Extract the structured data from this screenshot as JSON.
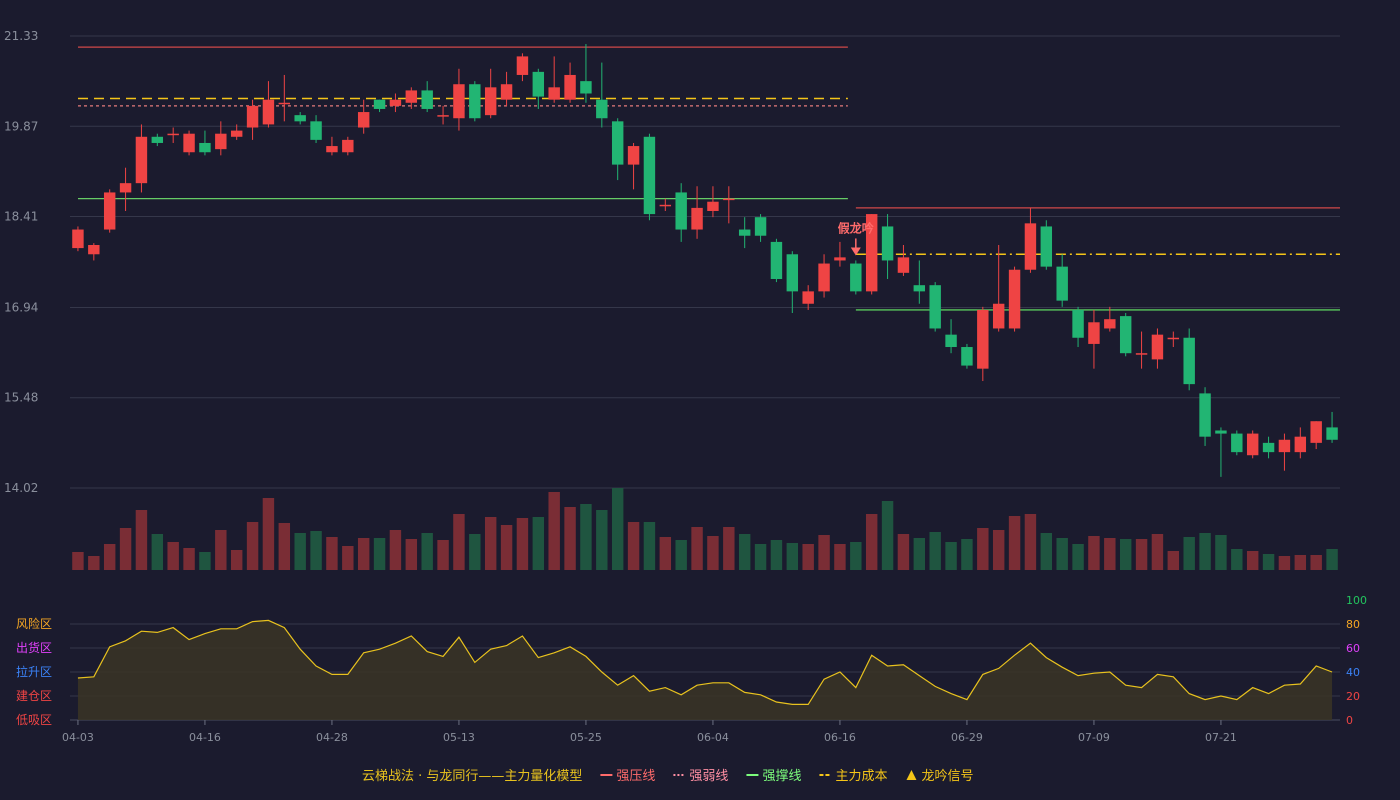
{
  "chart_data": {
    "type": "candlestick",
    "title": "",
    "colors": {
      "up": "#ef4444",
      "down": "#22b573",
      "vol_up": "#7a2d35",
      "vol_down": "#1f5540",
      "osc_line": "#e8c21e"
    },
    "y_axis": {
      "ticks": [
        "21.33",
        "19.87",
        "18.41",
        "16.94",
        "15.48",
        "14.02"
      ],
      "min": 14.02,
      "max": 21.33
    },
    "x_axis": {
      "ticks": [
        {
          "index": 0,
          "label": "04-03"
        },
        {
          "index": 8,
          "label": "04-16"
        },
        {
          "index": 16,
          "label": "04-28"
        },
        {
          "index": 24,
          "label": "05-13"
        },
        {
          "index": 32,
          "label": "05-25"
        },
        {
          "index": 40,
          "label": "06-04"
        },
        {
          "index": 48,
          "label": "06-16"
        },
        {
          "index": 56,
          "label": "06-29"
        },
        {
          "index": 64,
          "label": "07-09"
        },
        {
          "index": 72,
          "label": "07-21"
        }
      ]
    },
    "candles": [
      [
        17.9,
        18.2,
        18.25,
        17.85
      ],
      [
        17.8,
        17.95,
        17.98,
        17.7
      ],
      [
        18.2,
        18.8,
        18.85,
        18.15
      ],
      [
        18.8,
        18.95,
        19.2,
        18.5
      ],
      [
        18.95,
        19.7,
        19.9,
        18.8
      ],
      [
        19.7,
        19.6,
        19.75,
        19.55
      ],
      [
        19.75,
        19.75,
        19.85,
        19.6
      ],
      [
        19.45,
        19.75,
        19.8,
        19.4
      ],
      [
        19.6,
        19.45,
        19.8,
        19.4
      ],
      [
        19.5,
        19.75,
        19.95,
        19.4
      ],
      [
        19.7,
        19.8,
        19.9,
        19.65
      ],
      [
        19.85,
        20.2,
        20.3,
        19.65
      ],
      [
        19.9,
        20.3,
        20.6,
        19.85
      ],
      [
        20.25,
        20.25,
        20.7,
        19.95
      ],
      [
        20.05,
        19.95,
        20.1,
        19.9
      ],
      [
        19.95,
        19.65,
        20.05,
        19.6
      ],
      [
        19.45,
        19.55,
        19.7,
        19.4
      ],
      [
        19.45,
        19.65,
        19.7,
        19.4
      ],
      [
        19.85,
        20.1,
        20.3,
        19.75
      ],
      [
        20.3,
        20.15,
        20.3,
        20.1
      ],
      [
        20.2,
        20.3,
        20.4,
        20.1
      ],
      [
        20.25,
        20.45,
        20.5,
        20.15
      ],
      [
        20.45,
        20.15,
        20.6,
        20.1
      ],
      [
        20.05,
        20.05,
        20.2,
        19.9
      ],
      [
        20.0,
        20.55,
        20.8,
        19.8
      ],
      [
        20.55,
        20.0,
        20.6,
        19.95
      ],
      [
        20.05,
        20.5,
        20.8,
        20.0
      ],
      [
        20.3,
        20.55,
        20.75,
        20.2
      ],
      [
        20.7,
        21.0,
        21.05,
        20.6
      ],
      [
        20.75,
        20.35,
        20.8,
        20.15
      ],
      [
        20.3,
        20.5,
        21.0,
        20.25
      ],
      [
        20.3,
        20.7,
        20.9,
        20.25
      ],
      [
        20.6,
        20.4,
        21.2,
        20.25
      ],
      [
        20.3,
        20.0,
        20.9,
        19.85
      ],
      [
        19.95,
        19.25,
        20.0,
        19.0
      ],
      [
        19.25,
        19.55,
        19.6,
        18.85
      ],
      [
        19.7,
        18.45,
        19.75,
        18.35
      ],
      [
        18.6,
        18.6,
        18.7,
        18.5
      ],
      [
        18.8,
        18.2,
        18.95,
        18.0
      ],
      [
        18.2,
        18.55,
        18.9,
        18.05
      ],
      [
        18.5,
        18.65,
        18.9,
        18.4
      ],
      [
        18.7,
        18.7,
        18.9,
        18.3
      ],
      [
        18.2,
        18.1,
        18.4,
        17.9
      ],
      [
        18.4,
        18.1,
        18.45,
        18.0
      ],
      [
        18.0,
        17.4,
        18.05,
        17.35
      ],
      [
        17.8,
        17.2,
        17.85,
        16.85
      ],
      [
        17.0,
        17.2,
        17.3,
        16.9
      ],
      [
        17.2,
        17.65,
        17.8,
        17.1
      ],
      [
        17.7,
        17.75,
        18.0,
        17.6
      ],
      [
        17.65,
        17.2,
        17.7,
        17.15
      ],
      [
        17.2,
        18.45,
        18.45,
        17.15
      ],
      [
        18.25,
        17.7,
        18.45,
        17.4
      ],
      [
        17.5,
        17.75,
        17.95,
        17.45
      ],
      [
        17.3,
        17.2,
        17.7,
        17.0
      ],
      [
        17.3,
        16.6,
        17.35,
        16.55
      ],
      [
        16.5,
        16.3,
        16.75,
        16.2
      ],
      [
        16.3,
        16.0,
        16.35,
        15.95
      ],
      [
        15.95,
        16.9,
        16.95,
        15.75
      ],
      [
        16.6,
        17.0,
        17.95,
        16.55
      ],
      [
        16.6,
        17.55,
        17.6,
        16.55
      ],
      [
        17.55,
        18.3,
        18.55,
        17.5
      ],
      [
        18.25,
        17.6,
        18.35,
        17.55
      ],
      [
        17.6,
        17.05,
        17.8,
        16.95
      ],
      [
        16.9,
        16.45,
        16.95,
        16.3
      ],
      [
        16.35,
        16.7,
        16.9,
        15.95
      ],
      [
        16.6,
        16.75,
        16.95,
        16.55
      ],
      [
        16.8,
        16.2,
        16.85,
        16.15
      ],
      [
        16.2,
        16.2,
        16.55,
        15.95
      ],
      [
        16.1,
        16.5,
        16.6,
        15.95
      ],
      [
        16.45,
        16.45,
        16.55,
        16.3
      ],
      [
        16.45,
        15.7,
        16.6,
        15.6
      ],
      [
        15.55,
        14.85,
        15.65,
        14.7
      ],
      [
        14.95,
        14.9,
        15.0,
        14.2
      ],
      [
        14.9,
        14.6,
        14.95,
        14.55
      ],
      [
        14.55,
        14.9,
        14.95,
        14.5
      ],
      [
        14.75,
        14.6,
        14.85,
        14.5
      ],
      [
        14.6,
        14.8,
        14.9,
        14.3
      ],
      [
        14.6,
        14.85,
        15.0,
        14.5
      ],
      [
        14.75,
        15.1,
        15.1,
        14.65
      ],
      [
        15.0,
        14.8,
        15.25,
        14.75
      ]
    ],
    "volume": [
      18,
      14,
      26,
      42,
      60,
      36,
      28,
      22,
      18,
      40,
      20,
      48,
      72,
      47,
      37,
      39,
      33,
      24,
      32,
      32,
      40,
      31,
      37,
      30,
      56,
      36,
      53,
      45,
      52,
      53,
      78,
      63,
      66,
      60,
      82,
      48,
      48,
      33,
      30,
      43,
      34,
      43,
      36,
      26,
      30,
      27,
      26,
      35,
      26,
      28,
      56,
      69,
      36,
      32,
      38,
      28,
      31,
      42,
      40,
      54,
      56,
      37,
      32,
      26,
      34,
      32,
      31,
      31,
      36,
      19,
      33,
      37,
      35,
      21,
      19,
      16,
      14,
      15,
      15,
      21
    ],
    "oscillator": [
      35,
      36,
      61,
      66,
      74,
      73,
      77,
      67,
      72,
      76,
      76,
      82,
      83,
      77,
      59,
      45,
      38,
      38,
      56,
      59,
      64,
      70,
      57,
      53,
      69,
      48,
      59,
      62,
      70,
      52,
      56,
      61,
      53,
      40,
      29,
      37,
      24,
      27,
      21,
      29,
      31,
      31,
      23,
      21,
      15,
      13,
      13,
      34,
      40,
      27,
      54,
      45,
      46,
      37,
      28,
      22,
      17,
      38,
      43,
      54,
      64,
      52,
      44,
      37,
      39,
      40,
      29,
      27,
      38,
      36,
      22,
      17,
      20,
      17,
      27,
      22,
      29,
      30,
      45,
      40
    ],
    "osc_axis": {
      "ticks": [
        {
          "value": 0,
          "label": "0",
          "color": "#ef4444"
        },
        {
          "value": 20,
          "label": "20",
          "color": "#ef4444"
        },
        {
          "value": 40,
          "label": "40",
          "color": "#3b82f6"
        },
        {
          "value": 60,
          "label": "60",
          "color": "#e040fb"
        },
        {
          "value": 80,
          "label": "80",
          "color": "#f5a623"
        },
        {
          "value": 100,
          "label": "100",
          "color": "#22c55e"
        }
      ]
    },
    "zones": [
      {
        "label": "风险区",
        "value": 80,
        "color": "#f5a623"
      },
      {
        "label": "出货区",
        "value": 60,
        "color": "#e040fb"
      },
      {
        "label": "拉升区",
        "value": 40,
        "color": "#3b82f6"
      },
      {
        "label": "建仓区",
        "value": 20,
        "color": "#ef4444"
      },
      {
        "label": "低吸区",
        "value": 0,
        "color": "#ef4444"
      }
    ],
    "levels": [
      {
        "kind": "strong_resist",
        "from": 0,
        "to": 48,
        "value": 21.15,
        "color": "#d04848",
        "dash": "none"
      },
      {
        "kind": "main_cost",
        "from": 0,
        "to": 48,
        "value": 20.32,
        "color": "#f5c518",
        "dash": "10,6"
      },
      {
        "kind": "strong_weak",
        "from": 0,
        "to": 48,
        "value": 20.2,
        "color": "#e47b7b",
        "dash": "3,3"
      },
      {
        "kind": "strong_support",
        "from": 0,
        "to": 48,
        "value": 18.7,
        "color": "#66cc66",
        "dash": "none"
      },
      {
        "kind": "strong_resist",
        "from": 49,
        "to": 79,
        "value": 18.55,
        "color": "#d04848",
        "dash": "none"
      },
      {
        "kind": "main_cost",
        "from": 49,
        "to": 79,
        "value": 17.8,
        "color": "#f5c518",
        "dash": "10,4,2,4"
      },
      {
        "kind": "strong_support",
        "from": 49,
        "to": 79,
        "value": 16.9,
        "color": "#66ee66",
        "dash": "none"
      }
    ],
    "annotation": {
      "index": 49,
      "label": "假龙吟",
      "color": "#ff6b6b"
    },
    "legend": [
      {
        "text": "云梯战法 · 与龙同行——主力量化模型",
        "color": "#e8c21e",
        "marker": "none"
      },
      {
        "text": "强压线",
        "color": "#ff6b6b",
        "marker": "line"
      },
      {
        "text": "强弱线",
        "color": "#ff8fa3",
        "marker": "dotted"
      },
      {
        "text": "强撑线",
        "color": "#7CFC7C",
        "marker": "line"
      },
      {
        "text": "主力成本",
        "color": "#f5c518",
        "marker": "dashed"
      },
      {
        "text": "龙吟信号",
        "color": "#f5c518",
        "marker": "triangle"
      }
    ]
  }
}
